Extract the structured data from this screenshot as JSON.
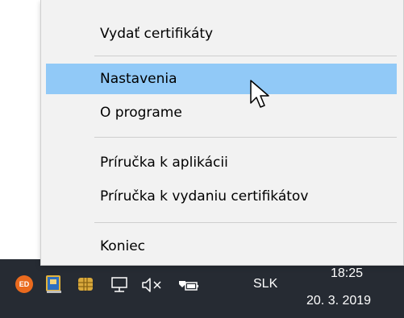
{
  "menu": {
    "items": [
      {
        "label": "Vydať certifikáty"
      },
      {
        "label": "Nastavenia"
      },
      {
        "label": "O programe"
      },
      {
        "label": "Príručka k aplikácii"
      },
      {
        "label": "Príručka k vydaniu certifikátov"
      },
      {
        "label": "Koniec"
      }
    ],
    "highlight_color": "#91c9f7"
  },
  "taskbar": {
    "background": "#262b33",
    "tray_icons": [
      "eid-app-icon",
      "smartcard-reader-icon",
      "chip-card-icon",
      "network-icon",
      "volume-muted-icon",
      "battery-plug-icon"
    ],
    "eid_badge": "ED",
    "language": "SLK",
    "clock": {
      "time": "18:25",
      "date": "20. 3. 2019"
    }
  }
}
